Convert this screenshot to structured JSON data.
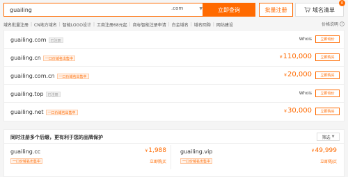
{
  "search": {
    "value": "guailing",
    "tld": ".com",
    "search_label": "立即查询",
    "bulk_label": "批量注册",
    "list_label": "域名清单",
    "cart_count": "0"
  },
  "nav": {
    "links": [
      "域名批量注册",
      "CN地方域名",
      "智能LOGO设计",
      "工商注册68元起",
      "商标智能注册申请",
      "白金域名",
      "域名回购",
      "网站建设"
    ],
    "help": "价格说明"
  },
  "results": [
    {
      "domain": "guailing.com",
      "tag": "已注册",
      "tag_type": "grey",
      "price": "",
      "status": "Whois",
      "action": "立即询价"
    },
    {
      "domain": "guailing.cn",
      "tag": "一口价域名出售中",
      "tag_type": "orange",
      "price": "110,000",
      "status": "",
      "action": "立即购买"
    },
    {
      "domain": "guailing.com.cn",
      "tag": "一口价域名出售中",
      "tag_type": "orange",
      "price": "20,000",
      "status": "",
      "action": "立即购买"
    },
    {
      "domain": "guailing.top",
      "tag": "已注册",
      "tag_type": "grey",
      "price": "",
      "status": "Whois",
      "action": "立即询价"
    },
    {
      "domain": "guailing.net",
      "tag": "一口价域名出售中",
      "tag_type": "orange",
      "price": "30,000",
      "status": "",
      "action": "立即购买"
    }
  ],
  "currency": "¥",
  "promo": {
    "title": "同时注册多个后缀，更有利于您的品牌保护",
    "filter_label": "筛选",
    "items": [
      {
        "domain": "guailing.cc",
        "tag": "一口价域名出售中",
        "price": "1,988",
        "buy": "立即购买"
      },
      {
        "domain": "guailing.vip",
        "tag": "一口价域名出售中",
        "price": "49,999",
        "buy": "立即购买"
      }
    ]
  },
  "colors": {
    "accent": "#ff6a00"
  },
  "icons": {
    "cart": "cart-icon",
    "caret": "chevron-down-icon",
    "help": "question-icon"
  }
}
